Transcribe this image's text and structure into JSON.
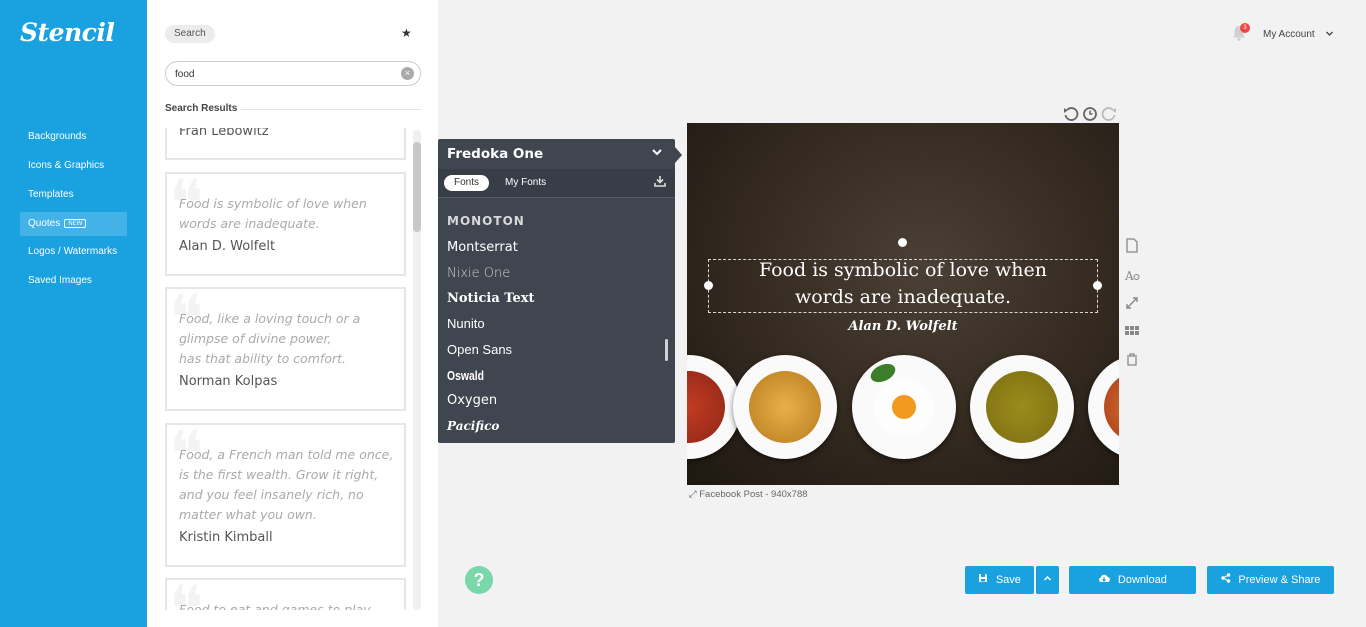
{
  "brand": "Stencil",
  "nav": {
    "items": [
      {
        "label": "Backgrounds"
      },
      {
        "label": "Icons & Graphics"
      },
      {
        "label": "Templates"
      },
      {
        "label": "Quotes",
        "badge": "NEW",
        "active": true
      },
      {
        "label": "Logos / Watermarks"
      },
      {
        "label": "Saved Images"
      }
    ]
  },
  "search": {
    "chip_label": "Search",
    "query": "food",
    "results_heading": "Search Results"
  },
  "results": [
    {
      "author": "Fran Lebowitz"
    },
    {
      "text": "Food is symbolic of love when words are inadequate.",
      "author": "Alan D. Wolfelt"
    },
    {
      "text": "Food, like a loving touch or a glimpse of divine power,\nhas that ability to comfort.",
      "author": "Norman Kolpas"
    },
    {
      "text": "Food, a French man told me once, is the first wealth. Grow it right, and you feel insanely rich, no matter what you own.",
      "author": "Kristin Kimball"
    },
    {
      "text": "Food to eat and games to play"
    }
  ],
  "font_picker": {
    "current": "Fredoka One",
    "tabs": [
      "Fonts",
      "My Fonts"
    ],
    "active_tab": "Fonts",
    "fonts": [
      "Monoton",
      "Montserrat",
      "Nixie One",
      "Noticia Text",
      "Nunito",
      "Open Sans",
      "Oswald",
      "Oxygen",
      "Pacifico"
    ]
  },
  "header": {
    "notification_count": "3",
    "account_label": "My Account"
  },
  "canvas": {
    "quote_line_1": "Food is symbolic of love when",
    "quote_line_2": "words are inadequate.",
    "author": "Alan D. Wolfelt",
    "size_label": "Facebook Post - 940x788"
  },
  "actions": {
    "save": "Save",
    "download": "Download",
    "preview_share": "Preview & Share"
  },
  "colors": {
    "brand_blue": "#1aa1e0",
    "dropdown_bg": "#3f4650",
    "help_green": "#79d7a9"
  }
}
